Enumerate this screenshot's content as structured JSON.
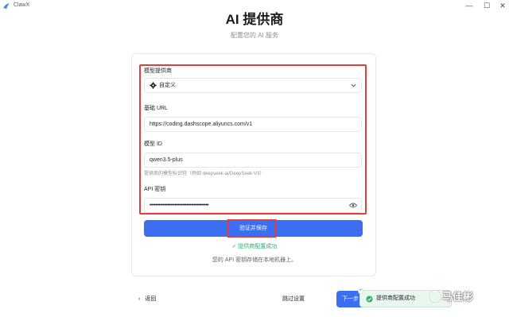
{
  "window": {
    "app_name": "ClawX",
    "minimize": "—",
    "maximize": "☐",
    "close": "✕"
  },
  "header": {
    "title": "AI 提供商",
    "subtitle": "配置您的 AI 服务"
  },
  "form": {
    "provider_label": "模型提供商",
    "provider_value": "自定义",
    "base_url_label": "基础 URL",
    "base_url_value": "https://coding.dashscope.aliyuncs.com/v1",
    "model_id_label": "模型 ID",
    "model_id_value": "qwen3.5-plus",
    "model_id_hint": "提供商的模型标识符（例如 deepseek-ai/DeepSeek-V3）",
    "api_key_label": "API 密钥",
    "api_key_masked": "••••••••••••••••••••••••••••••••••••••••",
    "verify_button": "验证并保存",
    "success_message": "✓ 提供商配置成功",
    "storage_note": "您的 API 密钥存储在本地机器上。"
  },
  "footer": {
    "back_label": "返回",
    "skip_label": "跳过设置",
    "next_label": "下一步"
  },
  "toast": {
    "message": "提供商配置成功"
  },
  "watermark": {
    "text": "马佳彬"
  },
  "colors": {
    "accent": "#3b6ef0",
    "highlight": "#e23d3d",
    "success": "#2fb06b"
  }
}
